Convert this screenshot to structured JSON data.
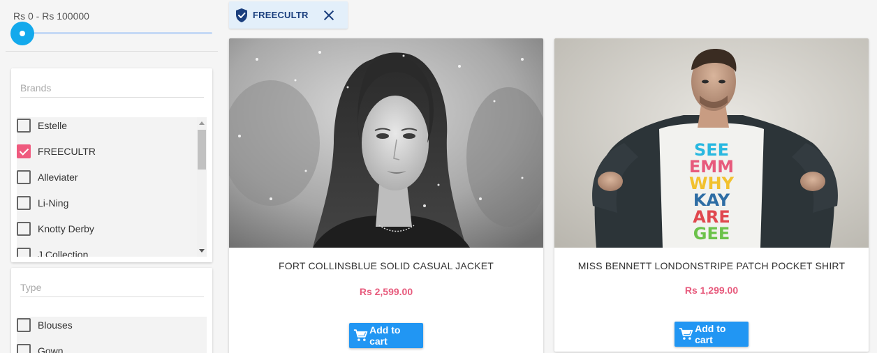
{
  "price_filter": {
    "range_label": "Rs 0 - Rs 100000",
    "slider_value_fraction": 0.0
  },
  "brands": {
    "placeholder": "Brands",
    "items": [
      {
        "label": "Estelle",
        "checked": false
      },
      {
        "label": "FREECULTR",
        "checked": true
      },
      {
        "label": "Alleviater",
        "checked": false
      },
      {
        "label": "Li-Ning",
        "checked": false
      },
      {
        "label": "Knotty Derby",
        "checked": false
      },
      {
        "label": "J Collection",
        "checked": false
      }
    ]
  },
  "type": {
    "placeholder": "Type",
    "items": [
      {
        "label": "Blouses",
        "checked": false
      },
      {
        "label": "Gown",
        "checked": false
      }
    ]
  },
  "active_filter_chip": {
    "label": "FREECULTR",
    "icon": "shield-check-icon",
    "close_icon": "close-icon"
  },
  "products": [
    {
      "name": "FORT COLLINSBLUE SOLID CASUAL JACKET",
      "price": "Rs 2,599.00",
      "button_label": "Add to cart",
      "image": "woman-snow-photo"
    },
    {
      "name": "MISS BENNETT LONDONSTRIPE PATCH POCKET SHIRT",
      "price": "Rs 1,299.00",
      "button_label": "Add to cart",
      "image": "man-graphic-tee-photo",
      "tee_print": [
        "SEE",
        "EMM",
        "WHY",
        "KAY",
        "ARE",
        "GEE"
      ]
    }
  ],
  "colors": {
    "accent": "#2196f3",
    "price": "#e75a7c",
    "checkbox_checked": "#ef5a7e",
    "slider": "#13a9ec",
    "chip_bg": "#e3effa"
  }
}
